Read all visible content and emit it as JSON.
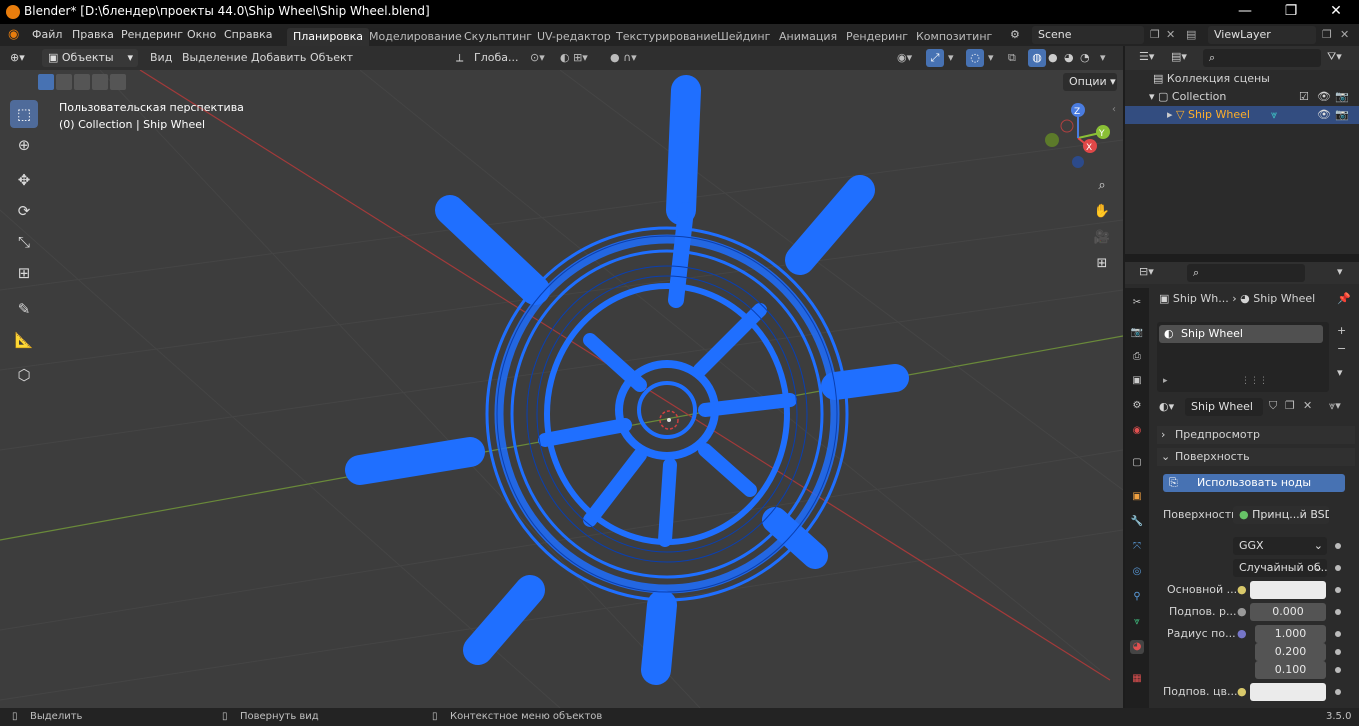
{
  "title": "Blender* [D:\\блендер\\проекты 44.0\\Ship Wheel\\Ship Wheel.blend]",
  "menus": [
    "Файл",
    "Правка",
    "Рендеринг",
    "Окно",
    "Справка"
  ],
  "workspaces": [
    "Планировка",
    "Моделирование",
    "Скульптинг",
    "UV-редактор",
    "Текстурирование",
    "Шейдинг",
    "Анимация",
    "Рендеринг",
    "Композитинг"
  ],
  "active_workspace": "Планировка",
  "scene": "Scene",
  "view_layer": "ViewLayer",
  "viewport": {
    "mode": "Объекты",
    "menus": [
      "Вид",
      "Выделение",
      "Добавить",
      "Объект"
    ],
    "orientation": "Глоба...",
    "options": "Опции",
    "perspective": "Пользовательская перспектива",
    "collection_info": "(0) Collection | Ship Wheel"
  },
  "gizmo": {
    "x": "X",
    "y": "Y",
    "z": "Z"
  },
  "outliner": {
    "scene_collection": "Коллекция сцены",
    "collection": "Collection",
    "object": "Ship Wheel"
  },
  "properties": {
    "breadcrumb_object": "Ship Wh...",
    "breadcrumb_material": "Ship Wheel",
    "slot_name": "Ship Wheel",
    "material_name": "Ship Wheel",
    "preview": "Предпросмотр",
    "surface_panel": "Поверхность",
    "use_nodes": "Использовать ноды",
    "surface_label": "Поверхность",
    "surface_value": "Принц...й BSDF",
    "distribution": "GGX",
    "subsurface_method": "Случайный об...",
    "base_color_label": "Основной ...",
    "subsurface_label": "Подпов. р...",
    "subsurface_value": "0.000",
    "radius_label": "Радиус по...",
    "radius_values": [
      "1.000",
      "0.200",
      "0.100"
    ],
    "subsurface_color_label": "Подпов. цв..."
  },
  "status": {
    "select": "Выделить",
    "rotate": "Повернуть вид",
    "context": "Контекстное меню объектов",
    "version": "3.5.0"
  },
  "colors": {
    "wire": "#1f6fff",
    "accent": "#4772b3",
    "grid": "#3d3d3d"
  }
}
